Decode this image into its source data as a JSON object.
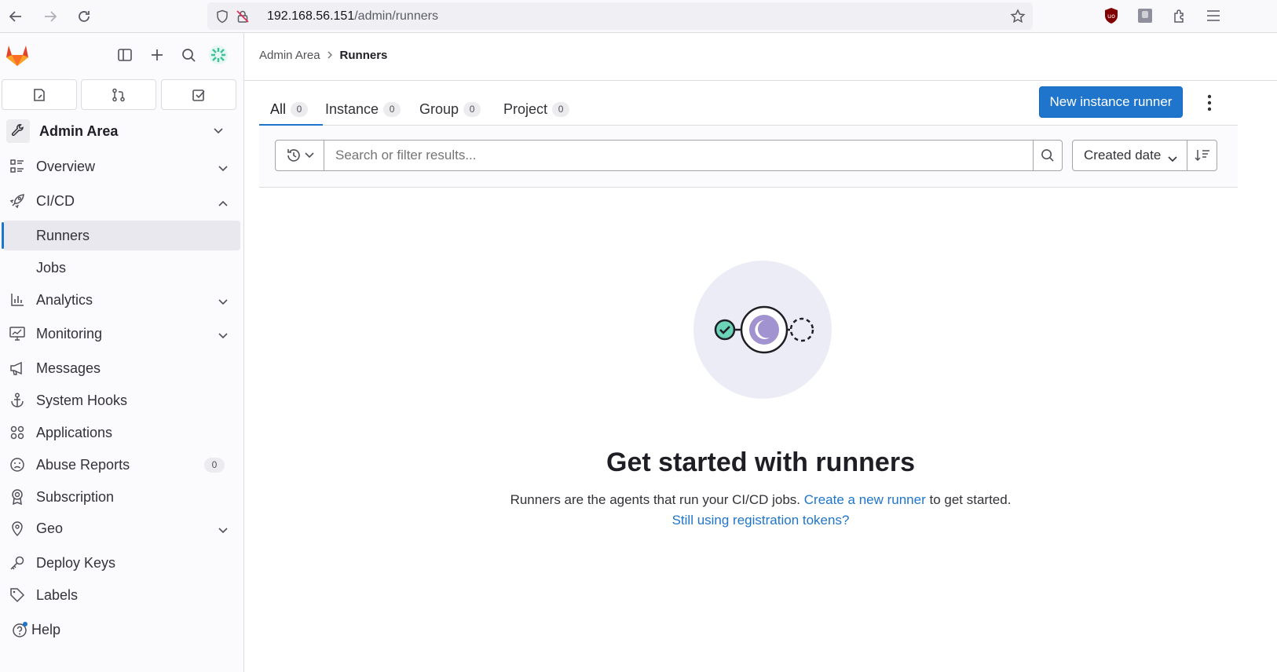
{
  "browser": {
    "url_host": "192.168.56.151",
    "url_path": "/admin/runners"
  },
  "sidebar": {
    "context_label": "Admin Area",
    "items": [
      {
        "label": "Overview"
      },
      {
        "label": "CI/CD"
      },
      {
        "label": "Runners"
      },
      {
        "label": "Jobs"
      },
      {
        "label": "Analytics"
      },
      {
        "label": "Monitoring"
      },
      {
        "label": "Messages"
      },
      {
        "label": "System Hooks"
      },
      {
        "label": "Applications"
      },
      {
        "label": "Abuse Reports",
        "count": "0"
      },
      {
        "label": "Subscription"
      },
      {
        "label": "Geo"
      },
      {
        "label": "Deploy Keys"
      },
      {
        "label": "Labels"
      }
    ],
    "help_label": "Help"
  },
  "breadcrumb": {
    "parent": "Admin Area",
    "current": "Runners"
  },
  "tabs": [
    {
      "label": "All",
      "count": "0"
    },
    {
      "label": "Instance",
      "count": "0"
    },
    {
      "label": "Group",
      "count": "0"
    },
    {
      "label": "Project",
      "count": "0"
    }
  ],
  "actions": {
    "new_runner_label": "New instance runner"
  },
  "filter": {
    "search_placeholder": "Search or filter results...",
    "sort_label": "Created date"
  },
  "empty_state": {
    "title": "Get started with runners",
    "desc_before": "Runners are the agents that run your CI/CD jobs. ",
    "desc_link": "Create a new runner",
    "desc_after": " to get started.",
    "tokens_link": "Still using registration tokens?"
  },
  "colors": {
    "accent": "#1f75cb",
    "gitlab_orange": "#e24329",
    "illustration_bg": "#ececf6",
    "illustration_purple": "#a193d0",
    "illustration_green": "#6bd3b8"
  }
}
